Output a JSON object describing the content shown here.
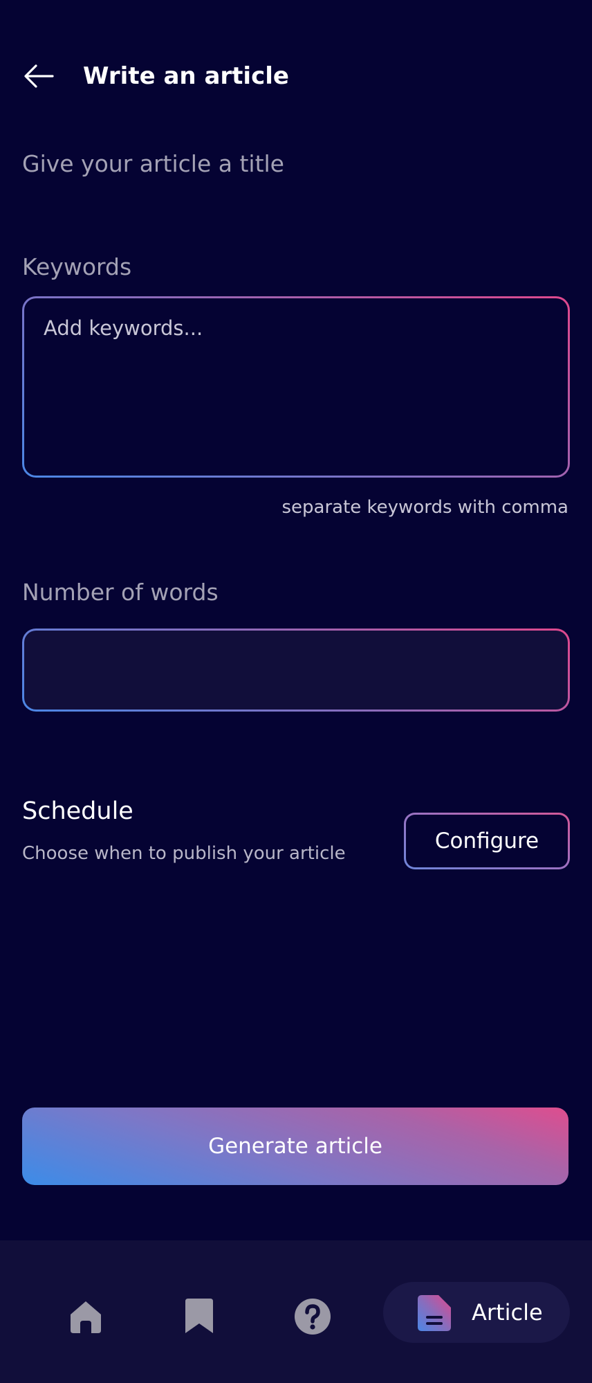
{
  "header": {
    "title": "Write an article",
    "back_icon": "arrow-left-icon"
  },
  "title_field": {
    "placeholder": "Give your article a title",
    "value": ""
  },
  "keywords": {
    "label": "Keywords",
    "placeholder": "Add keywords...",
    "value": "",
    "helper": "separate keywords with comma"
  },
  "words": {
    "label": "Number of words",
    "value": ""
  },
  "schedule": {
    "title": "Schedule",
    "description": "Choose when to publish your article",
    "button_label": "Configure"
  },
  "generate": {
    "label": "Generate article"
  },
  "nav": {
    "items": [
      {
        "icon": "home-icon",
        "label": "",
        "active": false
      },
      {
        "icon": "bookmark-icon",
        "label": "",
        "active": false
      },
      {
        "icon": "help-icon",
        "label": "",
        "active": false
      },
      {
        "icon": "article-icon",
        "label": "Article",
        "active": true
      }
    ]
  },
  "colors": {
    "background": "#050333",
    "surface": "#110e3a",
    "accent_blue": "#4b87e6",
    "accent_pink": "#e0488d",
    "muted_text": "#a4a2b5"
  }
}
